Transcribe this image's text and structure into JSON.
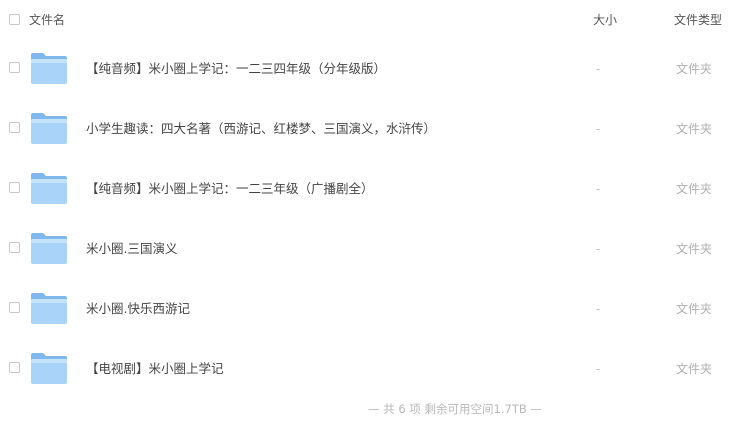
{
  "header": {
    "name_label": "文件名",
    "size_label": "大小",
    "type_label": "文件类型"
  },
  "files": [
    {
      "name": "【纯音频】米小圈上学记：一二三四年级（分年级版）",
      "size": "-",
      "type": "文件夹",
      "icon": "folder-icon"
    },
    {
      "name": "小学生趣读：四大名著（西游记、红楼梦、三国演义，水浒传）",
      "size": "-",
      "type": "文件夹",
      "icon": "folder-icon"
    },
    {
      "name": "【纯音频】米小圈上学记：一二三年级（广播剧全）",
      "size": "-",
      "type": "文件夹",
      "icon": "folder-icon"
    },
    {
      "name": "米小圈.三国演义",
      "size": "-",
      "type": "文件夹",
      "icon": "folder-icon"
    },
    {
      "name": "米小圈.快乐西游记",
      "size": "-",
      "type": "文件夹",
      "icon": "folder-icon"
    },
    {
      "name": "【电视剧】米小圈上学记",
      "size": "-",
      "type": "文件夹",
      "icon": "folder-icon"
    }
  ],
  "footer": {
    "summary": "— 共 6 项 剩余可用空间1.7TB —"
  },
  "colors": {
    "folder_light": "#b9dcfb",
    "folder_mid": "#8ec5f6",
    "folder_tab": "#7fb8ee"
  }
}
